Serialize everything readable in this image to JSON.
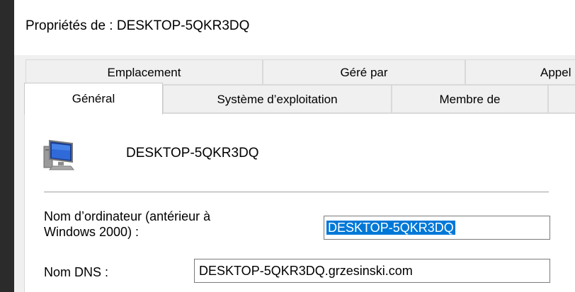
{
  "window": {
    "title": "Propriétés de : DESKTOP-5QKR3DQ"
  },
  "tabs": {
    "row1": [
      "Emplacement",
      "Géré par",
      "Appel"
    ],
    "row2": [
      "Général",
      "Système d’exploitation",
      "Membre de"
    ],
    "selected": "Général"
  },
  "general": {
    "computer_name": "DESKTOP-5QKR3DQ",
    "pre2000_label_line1": "Nom d’ordinateur (antérieur à",
    "pre2000_label_line2": "Windows 2000) :",
    "pre2000_value": "DESKTOP-5QKR3DQ",
    "dns_label": "Nom DNS :",
    "dns_value": "DESKTOP-5QKR3DQ.grzesinski.com"
  },
  "icons": {
    "computer": "computer-icon"
  },
  "colors": {
    "selection": "#0078d7",
    "panel": "#ffffff",
    "dialog": "#f0f0f0"
  }
}
